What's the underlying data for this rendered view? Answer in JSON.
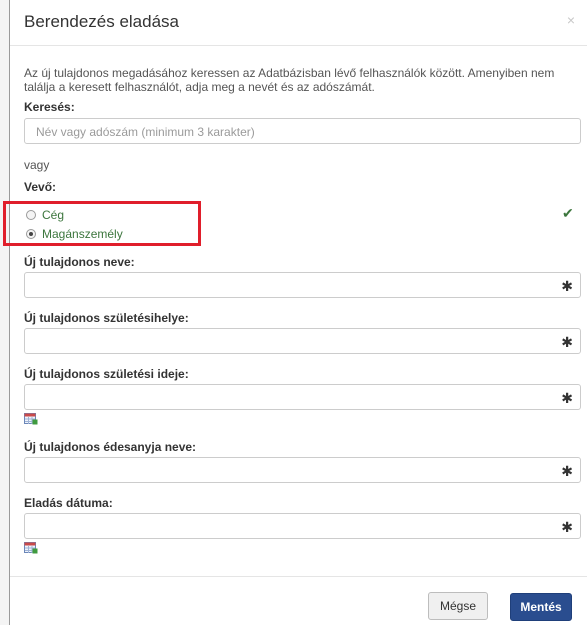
{
  "dialog": {
    "title": "Berendezés eladása",
    "close": "×",
    "intro": "Az új tulajdonos megadásához keressen az Adatbázisban lévő felhasználók között. Amenyiben nem találja a keresett felhasználót, adja meg a nevét és az adószámát."
  },
  "search": {
    "label": "Keresés:",
    "placeholder": "Név vagy adószám (minimum 3 karakter)"
  },
  "or_text": "vagy",
  "buyer": {
    "label": "Vevő:",
    "options": [
      {
        "label": "Cég",
        "checked": false
      },
      {
        "label": "Magánszemély",
        "checked": true
      }
    ],
    "valid_icon": "checkmark-icon"
  },
  "fields": [
    {
      "label": "Új tulajdonos neve:",
      "required": "✱",
      "calendar": false
    },
    {
      "label": "Új tulajdonos születésihelye:",
      "required": "✱",
      "calendar": false
    },
    {
      "label": "Új tulajdonos születési ideje:",
      "required": "✱",
      "calendar": true
    },
    {
      "label": "Új tulajdonos édesanyja neve:",
      "required": "✱",
      "calendar": false
    },
    {
      "label": "Eladás dátuma:",
      "required": "✱",
      "calendar": true
    }
  ],
  "buttons": {
    "cancel": "Mégse",
    "save": "Mentés"
  },
  "colors": {
    "accent": "#2a4d8f",
    "success": "#3c763d",
    "highlight": "#e01e2b"
  }
}
